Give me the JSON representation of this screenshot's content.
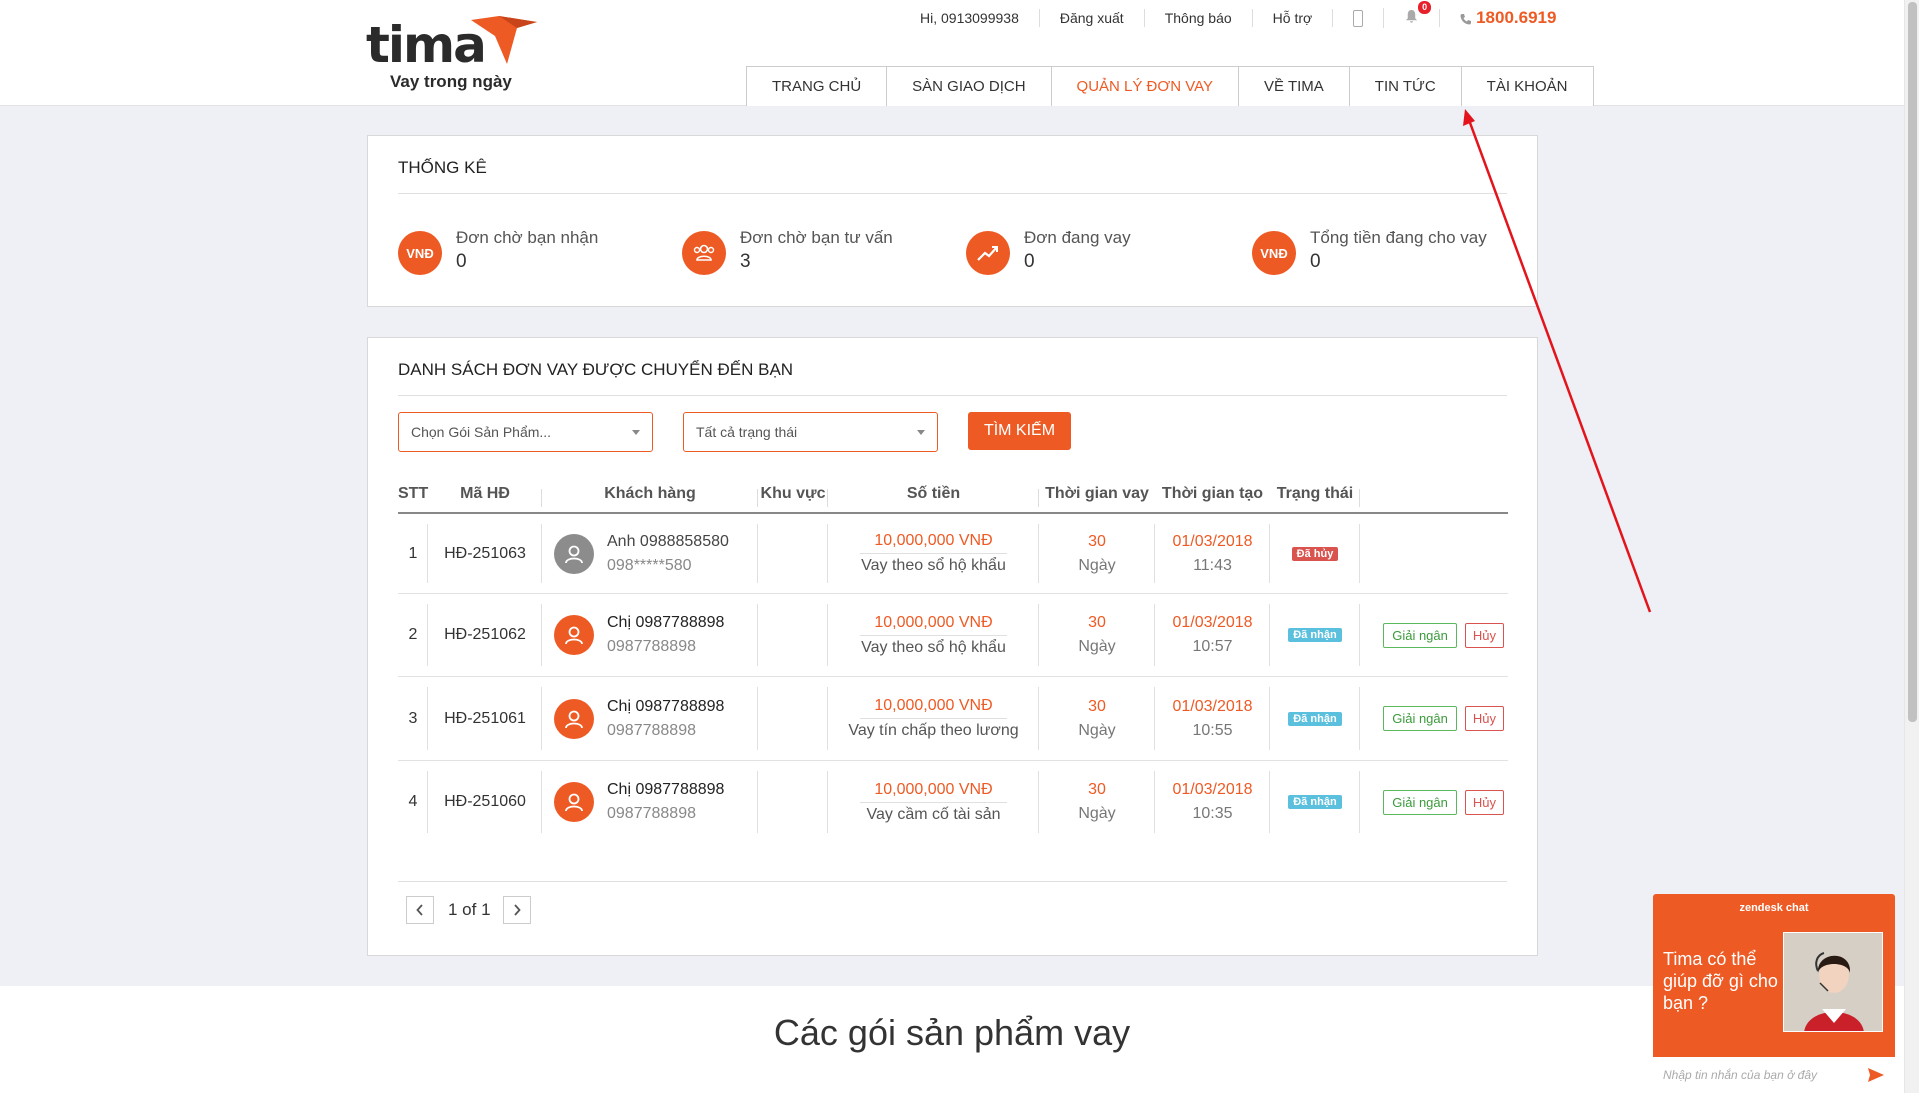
{
  "brand": {
    "logo_text": "tima",
    "tagline": "Vay trong ngày"
  },
  "topbar": {
    "greeting": "Hi, 0913099938",
    "logout": "Đăng xuất",
    "notifications": "Thông báo",
    "support": "Hỗ trợ",
    "notification_count": "0",
    "hotline": "1800.6919",
    "icons": [
      "mobile-icon",
      "bell-icon",
      "phone-icon"
    ]
  },
  "nav": {
    "items": [
      "TRANG CHỦ",
      "SÀN GIAO DỊCH",
      "QUẢN LÝ ĐƠN VAY",
      "VỀ TIMA",
      "TIN TỨC",
      "TÀI KHOẢN"
    ],
    "active_index": 2
  },
  "stats": {
    "title": "THỐNG KÊ",
    "items": [
      {
        "icon": "vnd-icon",
        "icon_text": "VNĐ",
        "label": "Đơn chờ bạn nhận",
        "value": "0"
      },
      {
        "icon": "users-icon",
        "icon_text": "",
        "label": "Đơn chờ bạn tư vấn",
        "value": "3"
      },
      {
        "icon": "trend-icon",
        "icon_text": "",
        "label": "Đơn đang vay",
        "value": "0"
      },
      {
        "icon": "vnd-icon",
        "icon_text": "VNĐ",
        "label": "Tổng tiền đang cho vay",
        "value": "0"
      }
    ]
  },
  "list": {
    "title": "DANH SÁCH ĐƠN VAY ĐƯỢC CHUYỂN ĐẾN BẠN",
    "product_select": "Chọn Gói Sản Phẩm...",
    "status_select": "Tất cả trạng thái",
    "search_button": "TÌM KIẾM",
    "columns": [
      "STT",
      "Mã HĐ",
      "Khách hàng",
      "Khu vực",
      "Số tiền",
      "Thời gian vay",
      "Thời gian tạo",
      "Trạng thái"
    ],
    "rows": [
      {
        "stt": "1",
        "code": "HĐ-251063",
        "name": "Anh 0988858580",
        "phone": "098*****580",
        "region": "",
        "amount": "10,000,000 VNĐ",
        "type": "Vay theo sổ hộ khẩu",
        "term": "30",
        "term_unit": "Ngày",
        "date": "01/03/2018",
        "time": "11:43",
        "status": "Đã hủy",
        "disburse": "",
        "cancel": ""
      },
      {
        "stt": "2",
        "code": "HĐ-251062",
        "name": "Chị 0987788898",
        "phone": "0987788898",
        "region": "",
        "amount": "10,000,000 VNĐ",
        "type": "Vay theo sổ hộ khẩu",
        "term": "30",
        "term_unit": "Ngày",
        "date": "01/03/2018",
        "time": "10:57",
        "status": "Đã nhận",
        "disburse": "Giải ngân",
        "cancel": "Hủy"
      },
      {
        "stt": "3",
        "code": "HĐ-251061",
        "name": "Chị 0987788898",
        "phone": "0987788898",
        "region": "",
        "amount": "10,000,000 VNĐ",
        "type": "Vay tín chấp theo lương",
        "term": "30",
        "term_unit": "Ngày",
        "date": "01/03/2018",
        "time": "10:55",
        "status": "Đã nhận",
        "disburse": "Giải ngân",
        "cancel": "Hủy"
      },
      {
        "stt": "4",
        "code": "HĐ-251060",
        "name": "Chị 0987788898",
        "phone": "0987788898",
        "region": "",
        "amount": "10,000,000 VNĐ",
        "type": "Vay cầm cố tài sản",
        "term": "30",
        "term_unit": "Ngày",
        "date": "01/03/2018",
        "time": "10:35",
        "status": "Đã nhận",
        "disburse": "Giải ngân",
        "cancel": "Hủy"
      }
    ],
    "pagination": "1 of 1"
  },
  "products_section": {
    "title": "Các gói sản phẩm vay"
  },
  "chat": {
    "brand": "zendesk chat",
    "message": "Tima có thể giúp đỡ gì cho bạn ?",
    "placeholder": "Nhập tin nhắn của bạn ở đây"
  },
  "colors": {
    "accent": "#ee5a24",
    "cancelled": "#d9534f",
    "received": "#5bc0de",
    "disburse": "#5cb85c",
    "annotation_arrow": "#e3141b"
  }
}
